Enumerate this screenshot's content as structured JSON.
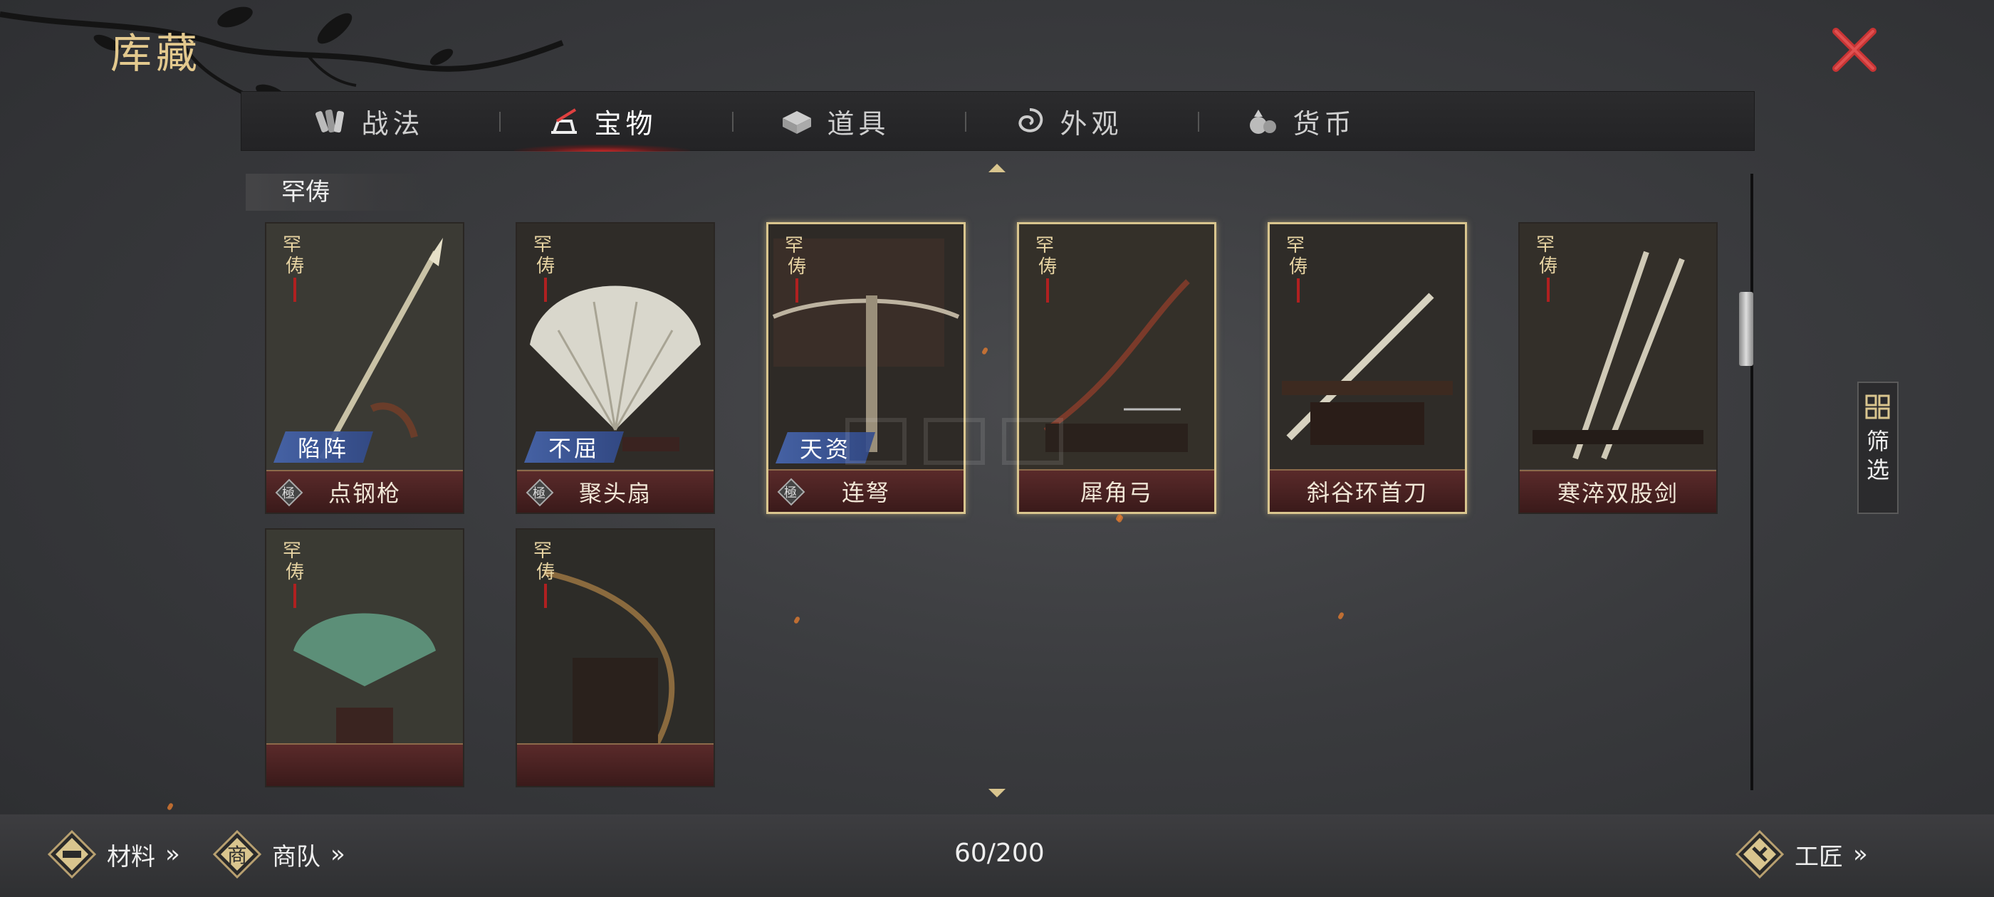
{
  "header": {
    "title": "库藏"
  },
  "tabs": [
    {
      "label": "战法",
      "icon": "scroll-bundle-icon",
      "active": false
    },
    {
      "label": "宝物",
      "icon": "treasure-stand-icon",
      "active": true
    },
    {
      "label": "道具",
      "icon": "box-icon",
      "active": false
    },
    {
      "label": "外观",
      "icon": "swirl-icon",
      "active": false
    },
    {
      "label": "货币",
      "icon": "money-bag-icon",
      "active": false
    }
  ],
  "section": {
    "label": "罕俦"
  },
  "cards": [
    {
      "name": "点钢枪",
      "trait": "陷阵",
      "rarity": "罕俦",
      "grade": "極",
      "art": "spear",
      "selected": false
    },
    {
      "name": "聚头扇",
      "trait": "不屈",
      "rarity": "罕俦",
      "grade": "極",
      "art": "feather-fan",
      "selected": false
    },
    {
      "name": "连弩",
      "trait": "天资",
      "rarity": "罕俦",
      "grade": "極",
      "art": "crossbow",
      "selected": true
    },
    {
      "name": "犀角弓",
      "trait": "",
      "rarity": "罕俦",
      "grade": "",
      "art": "bow",
      "selected": true
    },
    {
      "name": "斜谷环首刀",
      "trait": "",
      "rarity": "罕俦",
      "grade": "",
      "art": "saber",
      "selected": true
    },
    {
      "name": "寒淬双股剑",
      "trait": "",
      "rarity": "罕俦",
      "grade": "",
      "art": "twin-swords",
      "selected": false
    },
    {
      "name": "",
      "trait": "",
      "rarity": "罕俦",
      "grade": "",
      "art": "green-fan",
      "selected": false
    },
    {
      "name": "",
      "trait": "",
      "rarity": "罕俦",
      "grade": "",
      "art": "longbow",
      "selected": false
    }
  ],
  "filter": {
    "label_1": "筛",
    "label_2": "选"
  },
  "footer": {
    "materials": "材料",
    "caravan": "商队",
    "caravan_glyph": "商",
    "page_count": "60/200",
    "craftsman": "工匠",
    "chevrons": "»"
  },
  "colors": {
    "accent_gold": "#d9c58e",
    "title_gold": "#e3c98e",
    "tab_active_red": "#d22828",
    "trait_blue": "#4664aa",
    "close_red": "#d23a3a"
  }
}
